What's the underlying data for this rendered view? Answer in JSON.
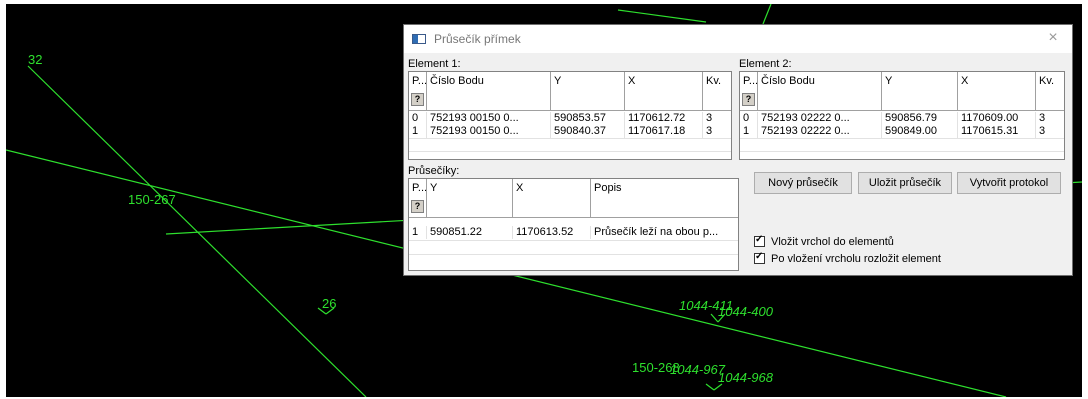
{
  "cad_labels": {
    "l32": "32",
    "l150_267": "150-267",
    "l26": "26",
    "l1044_411": "1044-411",
    "l1044_400": "1044-400",
    "l150_268": "150-268",
    "l1044_967": "1044-967",
    "l1044_968": "1044-968"
  },
  "dialog": {
    "title": "Průsečík přímek",
    "close_glyph": "×",
    "element1": {
      "label": "Element 1:",
      "columns": [
        "P...",
        "Číslo Bodu",
        "Y",
        "X",
        "Kv."
      ],
      "rows": [
        [
          "0",
          "752193 00150 0...",
          "590853.57",
          "1170612.72",
          "3"
        ],
        [
          "1",
          "752193 00150 0...",
          "590840.37",
          "1170617.18",
          "3"
        ]
      ]
    },
    "element2": {
      "label": "Element 2:",
      "columns": [
        "P...",
        "Číslo Bodu",
        "Y",
        "X",
        "Kv."
      ],
      "rows": [
        [
          "0",
          "752193 02222 0...",
          "590856.79",
          "1170609.00",
          "3"
        ],
        [
          "1",
          "752193 02222 0...",
          "590849.00",
          "1170615.31",
          "3"
        ]
      ]
    },
    "intersections": {
      "label": "Průsečíky:",
      "columns": [
        "P...",
        "Y",
        "X",
        "Popis"
      ],
      "rows": [
        [
          "1",
          "590851.22",
          "1170613.52",
          "Průsečík leží na obou p..."
        ]
      ]
    },
    "buttons": {
      "new_label": "Nový průsečík",
      "save_label": "Uložit průsečík",
      "protocol_label": "Vytvořit protokol"
    },
    "checkboxes": {
      "insert_vertex": "Vložit vrchol do elementů",
      "split_element": "Po vložení vrcholu rozložit element"
    },
    "help_glyph": "?"
  },
  "colors": {
    "cad_background": "#000000",
    "cad_line": "#2ee02e",
    "dialog_background": "#f0f0f0"
  }
}
